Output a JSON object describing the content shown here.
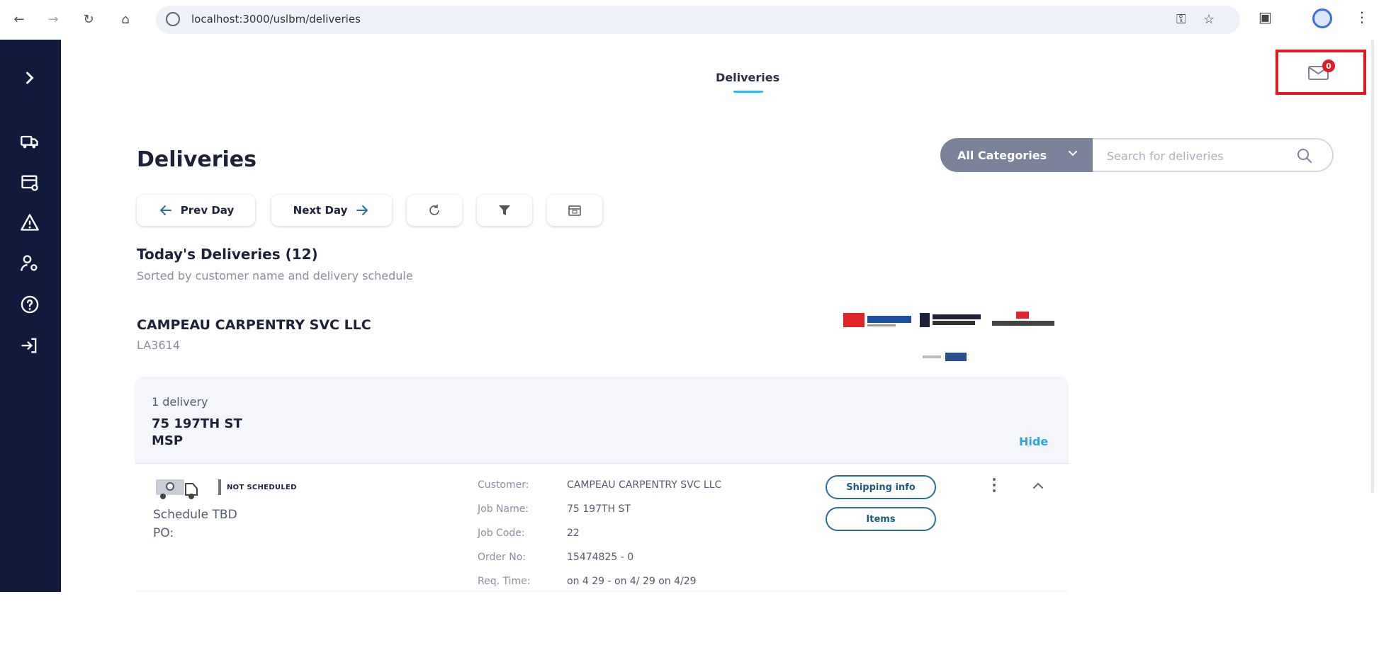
{
  "browser": {
    "url": "localhost:3000/uslbm/deliveries"
  },
  "header": {
    "nav_title": "Deliveries",
    "notification_count": "0"
  },
  "page": {
    "title": "Deliveries",
    "categories_label": "All Categories",
    "search_placeholder": "Search for deliveries"
  },
  "toolbar": {
    "prev_day": "Prev Day",
    "next_day": "Next Day"
  },
  "summary": {
    "title": "Today's Deliveries (12)",
    "subtitle": "Sorted by customer name and delivery schedule"
  },
  "customer": {
    "name": "CAMPEAU CARPENTRY SVC LLC",
    "code": "LA3614"
  },
  "delivery_group": {
    "count_label": "1 delivery",
    "address_line1": "75 197TH ST",
    "address_line2": "MSP",
    "hide_label": "Hide"
  },
  "delivery": {
    "status": "NOT SCHEDULED",
    "schedule": "Schedule TBD",
    "po": "PO:",
    "fields": [
      {
        "label": "Customer:",
        "value": "CAMPEAU CARPENTRY SVC LLC"
      },
      {
        "label": "Job Name:",
        "value": "75 197TH ST"
      },
      {
        "label": "Job Code:",
        "value": "22"
      },
      {
        "label": "Order No:",
        "value": "15474825 - 0"
      },
      {
        "label": "Req. Time:",
        "value": "on 4 29 - on 4/ 29 on 4/29"
      }
    ],
    "shipping_info_label": "Shipping info",
    "items_label": "Items"
  },
  "colors": {
    "sidebar": "#111a3d",
    "accent": "#38b6e4",
    "highlight": "#e01b24",
    "button_outline": "#2b6d92"
  },
  "icons": {
    "sidebar": [
      "expand-chevron-icon",
      "truck-icon",
      "billing-icon",
      "warning-icon",
      "user-settings-icon",
      "help-icon",
      "logout-icon"
    ]
  }
}
